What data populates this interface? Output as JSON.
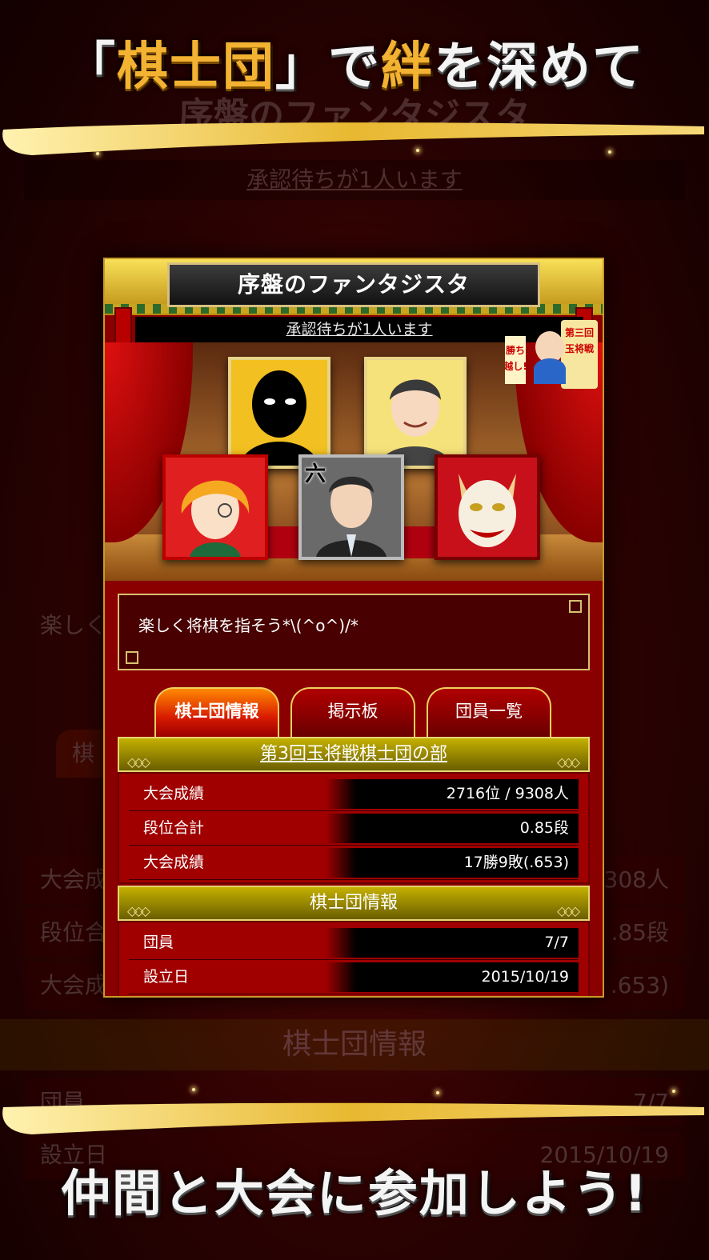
{
  "promo": {
    "headline_top": {
      "open": "「",
      "highlight1": "棋士団",
      "close": "」",
      "middle1": "で",
      "highlight2": "絆",
      "middle2": "を深めて"
    },
    "headline_bottom": "仲間と大会に参加しよう!"
  },
  "background": {
    "title": "序盤のファンタジスタ",
    "pending": "承認待ちが1人います",
    "motto_partial": "楽しく",
    "tab_partial": "棋",
    "section": "棋士団情報",
    "rows": [
      "大会成",
      "段位合",
      "大会成",
      "団員",
      "設立日"
    ],
    "values": [
      "308人",
      ".85段",
      ".653)",
      "7/7",
      "2015/10/19"
    ]
  },
  "clan": {
    "name": "序盤のファンタジスタ",
    "pending_notice": "承認待ちが1人います",
    "badge_text": "第三回玉将戦 勝ち越し!",
    "rank_mark": "六",
    "motto": "楽しく将棋を指そう*\\(^o^)/*"
  },
  "tabs": [
    {
      "label": "棋士団情報",
      "active": true
    },
    {
      "label": "掲示板",
      "active": false
    },
    {
      "label": "団員一覧",
      "active": false
    }
  ],
  "tournament": {
    "heading": "第3回玉将戦棋士団の部",
    "rows": [
      {
        "label": "大会成績",
        "value": "2716位 / 9308人"
      },
      {
        "label": "段位合計",
        "value": "0.85段"
      },
      {
        "label": "大会成績",
        "value": "17勝9敗(.653)"
      }
    ]
  },
  "info": {
    "heading": "棋士団情報",
    "rows": [
      {
        "label": "団員",
        "value": "7/7"
      },
      {
        "label": "設立日",
        "value": "2015/10/19"
      }
    ]
  },
  "colors": {
    "accent_gold": "#f3b232",
    "card_red": "#8a0000",
    "section_olive": "#8a7c00",
    "tab_active": "#ff6a00"
  }
}
